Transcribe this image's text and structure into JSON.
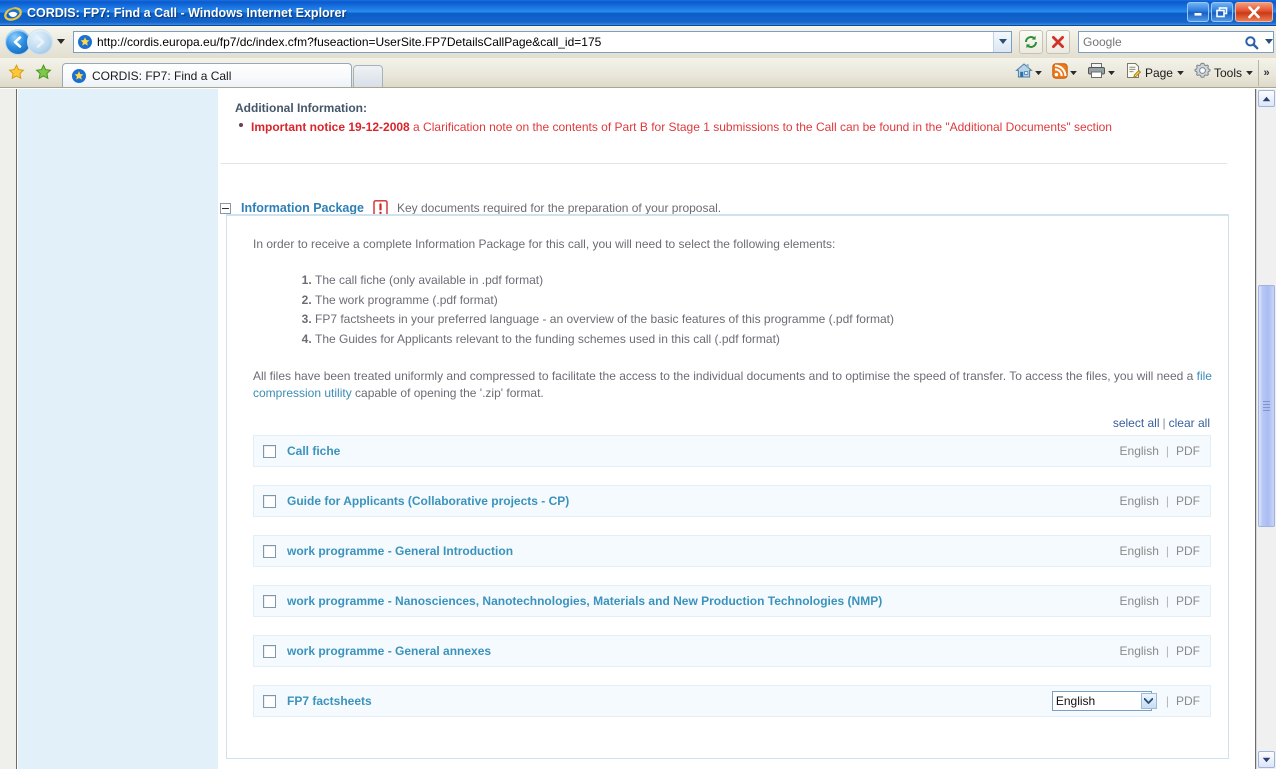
{
  "window": {
    "title": "CORDIS: FP7: Find a Call - Windows Internet Explorer",
    "icon": "ie-logo-icon",
    "minimize_label": "Minimize",
    "restore_label": "Restore",
    "close_label": "Close"
  },
  "navbar": {
    "back_label": "Back",
    "forward_label": "Forward",
    "history_dropdown_label": "Recent Pages",
    "address": "http://cordis.europa.eu/fp7/dc/index.cfm?fuseaction=UserSite.FP7DetailsCallPage&call_id=175",
    "address_dropdown_label": "Address dropdown",
    "refresh_label": "Refresh",
    "stop_label": "Stop",
    "search_placeholder": "Google",
    "search_value": "",
    "search_go_label": "Search",
    "search_dropdown_label": "Search provider"
  },
  "tabbar": {
    "favorites_label": "Favorites Center",
    "add_favorites_label": "Add to Favorites",
    "tabs": [
      {
        "label": "CORDIS: FP7: Find a Call",
        "active": true
      }
    ],
    "newtab_label": "New Tab"
  },
  "commandbar": {
    "items": [
      {
        "icon": "home-icon",
        "label": "",
        "caret": true
      },
      {
        "icon": "rss-feed-icon",
        "label": "",
        "caret": true
      },
      {
        "icon": "printer-icon",
        "label": "",
        "caret": true
      },
      {
        "icon": "page-icon",
        "label": "Page",
        "caret": true
      },
      {
        "icon": "gear-icon",
        "label": "Tools",
        "caret": true
      }
    ],
    "overflow_label": "»"
  },
  "page": {
    "additional_information": {
      "heading": "Additional Information:",
      "notice_strong": "Important notice 19-12-2008",
      "notice_rest": " a Clarification note on the contents of Part B for Stage 1 submissions to the Call can be found in the \"Additional Documents\" section"
    },
    "information_package": {
      "toggle_state": "expanded",
      "title": "Information Package",
      "warning_icon": "warning-exclamation-icon",
      "subtitle": "Key documents required for the preparation of your proposal.",
      "intro": "In order to receive a complete Information Package for this call, you will need to select the following elements:",
      "list": [
        "The call fiche (only available in .pdf format)",
        "The work programme (.pdf format)",
        "FP7 factsheets in your preferred language - an overview of the basic features of this programme (.pdf format)",
        "The Guides for Applicants relevant to the funding schemes used in this call (.pdf format)"
      ],
      "note_part1": "All files have been treated uniformly and compressed to facilitate the access to the individual documents and to optimise the speed of transfer. To access the files, you will need a ",
      "note_link": "file compression utility",
      "note_part2": " capable of opening the '.zip' format.",
      "select_all_label": "select all",
      "clear_all_label": "clear all",
      "separator": "|",
      "documents": [
        {
          "checked": false,
          "title": "Call fiche",
          "language": "English",
          "has_select": false,
          "format": "PDF"
        },
        {
          "checked": false,
          "title": "Guide for Applicants (Collaborative projects - CP)",
          "language": "English",
          "has_select": false,
          "format": "PDF"
        },
        {
          "checked": false,
          "title": "work programme - General Introduction",
          "language": "English",
          "has_select": false,
          "format": "PDF"
        },
        {
          "checked": false,
          "title": "work programme - Nanosciences, Nanotechnologies, Materials and New Production Technologies (NMP)",
          "language": "English",
          "has_select": false,
          "format": "PDF"
        },
        {
          "checked": false,
          "title": "work programme - General annexes",
          "language": "English",
          "has_select": false,
          "format": "PDF"
        },
        {
          "checked": false,
          "title": "FP7 factsheets",
          "language": "English",
          "has_select": true,
          "language_options": [
            "English"
          ],
          "format": "PDF"
        }
      ]
    }
  },
  "scrollbar": {
    "up_label": "Scroll up",
    "down_label": "Scroll down",
    "thumb_label": "Scroll thumb"
  },
  "colors": {
    "title_bar": "#0a5ad0",
    "link_blue": "#3b93bd",
    "notice_red": "#d8252a",
    "panel_border": "#cfe2ee",
    "row_bg": "#f4fafd",
    "sidebar_blue": "#e2f0fa"
  }
}
